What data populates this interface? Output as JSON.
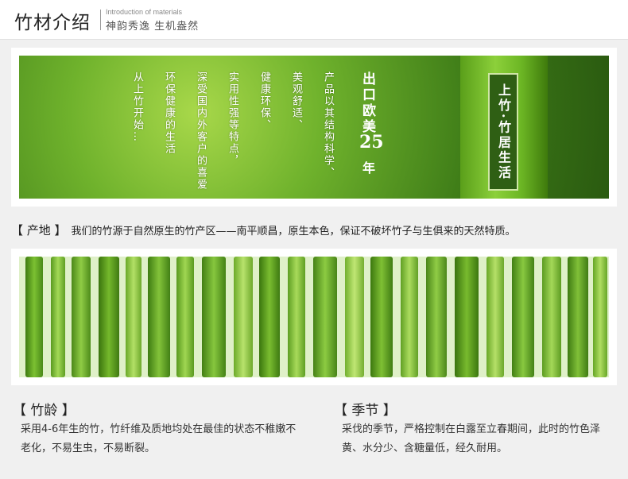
{
  "header": {
    "title": "竹材介绍",
    "en": "Introduction of materials",
    "subtitle": "神韵秀逸  生机盎然"
  },
  "banner1": {
    "columns": [
      "产品以其结构科学、",
      "美观舒适、",
      "健康环保、",
      "实用性强等特点，",
      "深受国内外客户的喜爱",
      "环保健康的生活",
      "从上竹开始…"
    ],
    "export_text": "出口欧美",
    "years": "25",
    "year_unit": "年",
    "seal": "上竹·竹居生活"
  },
  "origin": {
    "tag": "【 产地 】",
    "text": "我们的竹源于自然原生的竹产区——南平顺昌，原生本色，保证不破坏竹子与生俱来的天然特质。"
  },
  "age": {
    "tag": "【 竹龄 】",
    "text": "采用4-6年生的竹，竹纤维及质地均处在最佳的状态不稚嫩不老化，不易生虫，不易断裂。"
  },
  "season": {
    "tag": "【 季节 】",
    "text": "采伐的季节，严格控制在白露至立春期间，此时的竹色泽黄、水分少、含糖量低，经久耐用。"
  }
}
